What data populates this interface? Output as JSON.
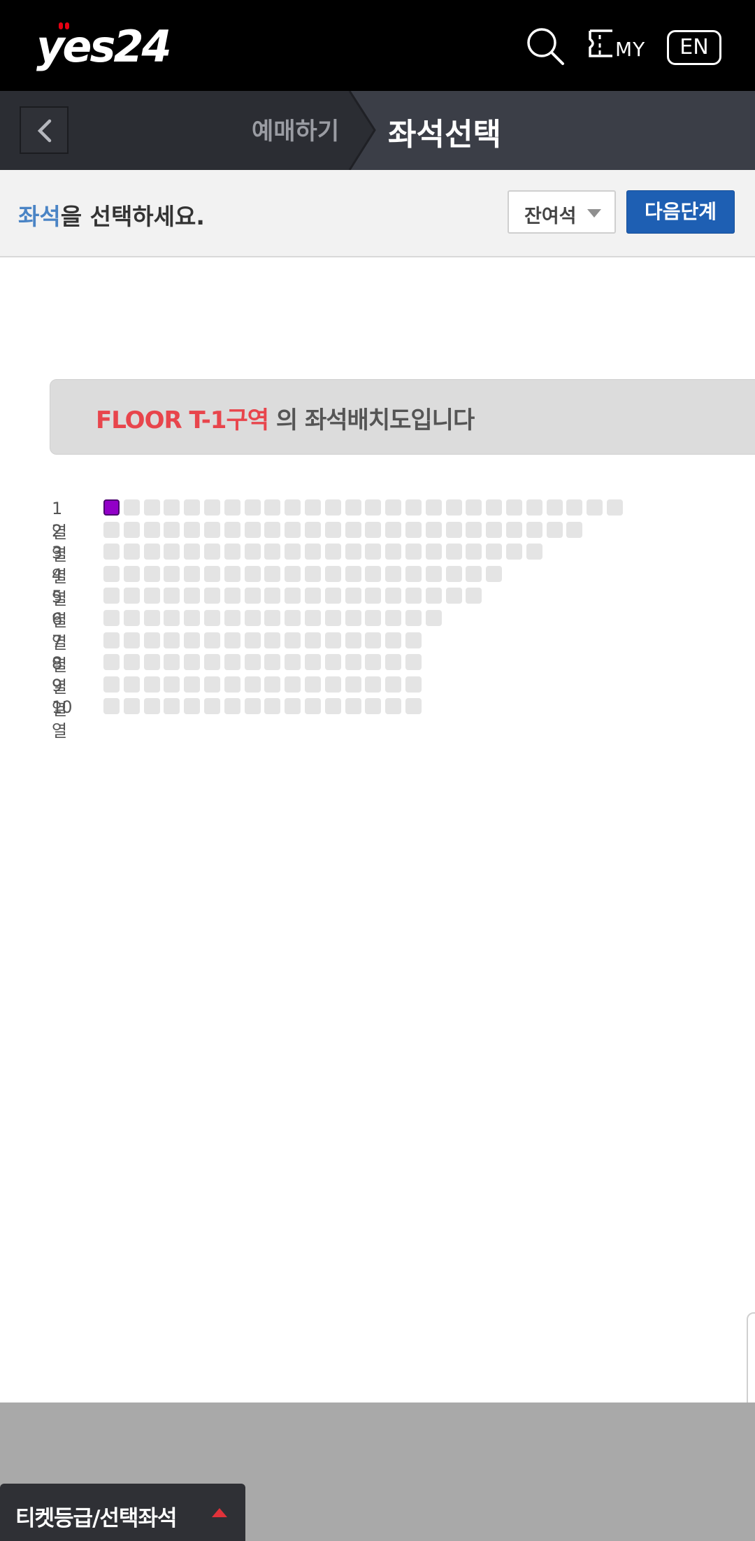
{
  "header": {
    "logo_text": "yes24",
    "my_label": "MY",
    "lang_label": "EN",
    "icons": [
      "search-icon",
      "my-ticket-icon"
    ],
    "logo_dot_color": "#e60012"
  },
  "steps": {
    "previous": "예매하기",
    "current": "좌석선택"
  },
  "instruction": {
    "highlight": "좌석",
    "rest": "을 선택하세요.",
    "remaining_seats_label": "잔여석",
    "next_label": "다음단계",
    "highlight_color": "#4a84c5",
    "next_color": "#1e5fb3"
  },
  "zone": {
    "name": "FLOOR T-1구역",
    "suffix": " 의 좌석배치도입니다",
    "name_color": "#e8454c"
  },
  "seat_rows": [
    {
      "label": "1열",
      "seats": 26,
      "selected": [
        1
      ]
    },
    {
      "label": "2열",
      "seats": 24,
      "selected": []
    },
    {
      "label": "3열",
      "seats": 22,
      "selected": []
    },
    {
      "label": "4열",
      "seats": 20,
      "selected": []
    },
    {
      "label": "5열",
      "seats": 19,
      "selected": []
    },
    {
      "label": "6열",
      "seats": 17,
      "selected": []
    },
    {
      "label": "7열",
      "seats": 16,
      "selected": []
    },
    {
      "label": "8열",
      "seats": 16,
      "selected": []
    },
    {
      "label": "9열",
      "seats": 16,
      "selected": []
    },
    {
      "label": "10열",
      "seats": 16,
      "selected": []
    }
  ],
  "seat_colors": {
    "available": "#e4e4e4",
    "selected": "#9200c8"
  },
  "bottom": {
    "ticket_tab_label": "티켓등급/선택좌석"
  }
}
